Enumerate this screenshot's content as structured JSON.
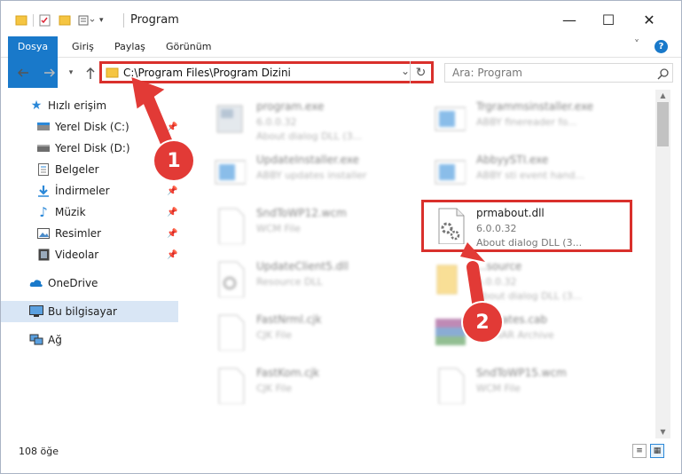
{
  "window": {
    "title": "Program",
    "controls": [
      "—",
      "☐",
      "✕"
    ]
  },
  "ribbon": {
    "tabs": [
      "Dosya",
      "Giriş",
      "Paylaş",
      "Görünüm"
    ],
    "expand_icon": "˅",
    "help_icon": "?"
  },
  "address": {
    "path": "C:\\Program Files\\Program Dizini",
    "search_placeholder": "Ara: Program"
  },
  "nav": {
    "quick_access": "Hızlı erişim",
    "items": [
      {
        "label": "Yerel Disk (C:)",
        "icon": "drive-icon",
        "pinned": true
      },
      {
        "label": "Yerel Disk (D:)",
        "icon": "drive-icon",
        "pinned": false
      },
      {
        "label": "Belgeler",
        "icon": "documents-icon",
        "pinned": true
      },
      {
        "label": "İndirmeler",
        "icon": "downloads-icon",
        "pinned": true
      },
      {
        "label": "Müzik",
        "icon": "music-icon",
        "pinned": true
      },
      {
        "label": "Resimler",
        "icon": "pictures-icon",
        "pinned": true
      },
      {
        "label": "Videolar",
        "icon": "videos-icon",
        "pinned": true
      }
    ],
    "onedrive": "OneDrive",
    "this_pc": "Bu bilgisayar",
    "network": "Ağ"
  },
  "files": [
    {
      "name": "program.exe",
      "l2": "6.0.0.32",
      "l3": "About dialog DLL (3...",
      "icon": "exe-icon"
    },
    {
      "name": "Trgrammsinstaller.exe",
      "l2": "ABBY finereader fo...",
      "l3": "",
      "icon": "installer-icon"
    },
    {
      "name": "UpdateInstaller.exe",
      "l2": "ABBY updates installer",
      "l3": "",
      "icon": "installer-icon"
    },
    {
      "name": "AbbyySTI.exe",
      "l2": "ABBY sti event hand...",
      "l3": "",
      "icon": "installer-icon"
    },
    {
      "name": "SndToWP12.wcm",
      "l2": "WCM File",
      "l3": "",
      "icon": "file-icon"
    },
    {
      "name": "prmabout.dll",
      "l2": "6.0.0.32",
      "l3": "About dialog DLL (3...",
      "icon": "dll-gear-icon"
    },
    {
      "name": "UpdateClient5.dll",
      "l2": "Resource DLL",
      "l3": "",
      "icon": "dll-gear-icon"
    },
    {
      "name": "...source",
      "l2": "6.0.0.32",
      "l3": "About dialog DLL (3...",
      "icon": "folder-icon"
    },
    {
      "name": "FastNrml.cjk",
      "l2": "CJK File",
      "l3": "",
      "icon": "file-icon"
    },
    {
      "name": "...ificates.cab",
      "l2": "WinRAR Archive",
      "l3": "",
      "icon": "archive-icon"
    },
    {
      "name": "FastKom.cjk",
      "l2": "CJK File",
      "l3": "",
      "icon": "file-icon"
    },
    {
      "name": "SndToWP15.wcm",
      "l2": "WCM File",
      "l3": "",
      "icon": "file-icon"
    }
  ],
  "status": {
    "count": "108 öğe"
  },
  "annotations": {
    "badge1": "1",
    "badge2": "2",
    "accent": "#d9302c"
  }
}
